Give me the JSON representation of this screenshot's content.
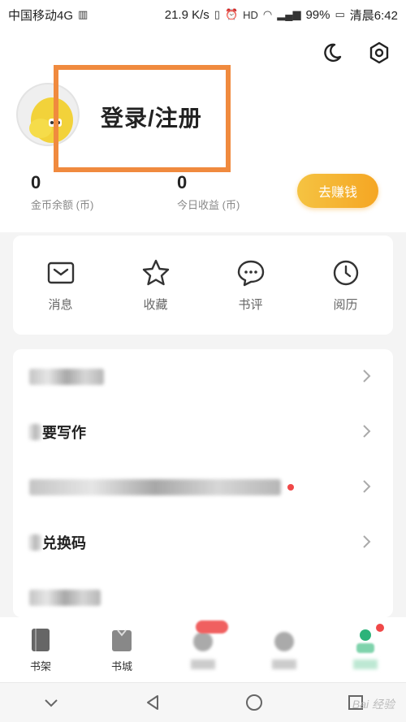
{
  "status_bar": {
    "carrier": "中国移动4G",
    "speed": "21.9 K/s",
    "battery": "99%",
    "time": "清晨6:42"
  },
  "header": {
    "login_label": "登录/注册",
    "coins": {
      "value": "0",
      "label": "金币余额 (币)"
    },
    "today": {
      "value": "0",
      "label": "今日收益 (币)"
    },
    "earn_button": "去赚钱"
  },
  "quick_actions": [
    {
      "label": "消息",
      "icon": "message-icon"
    },
    {
      "label": "收藏",
      "icon": "star-icon"
    },
    {
      "label": "书评",
      "icon": "comment-icon"
    },
    {
      "label": "阅历",
      "icon": "clock-icon"
    }
  ],
  "menu": {
    "row_2": "要写作",
    "row_4": "兑换码"
  },
  "tabbar": {
    "tab_1": "书架",
    "tab_2": "书城"
  },
  "watermark": "Bai 经验",
  "colors": {
    "accent": "#f5a623",
    "highlight_box": "#f08a3e",
    "dot": "#f04848"
  }
}
